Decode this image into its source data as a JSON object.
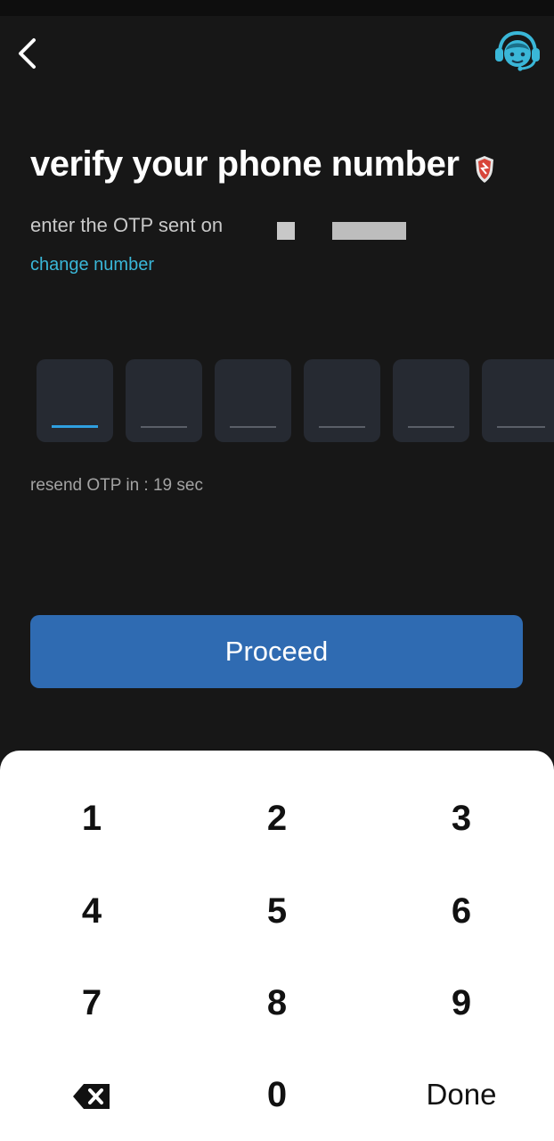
{
  "header": {
    "back_icon": "chevron-left-icon",
    "support_icon": "support-agent-headset-icon"
  },
  "title": "verify your phone number",
  "title_badge_icon": "shield-icon",
  "subtitle": "enter the OTP sent on",
  "change_number_label": "change number",
  "otp": {
    "length": 6,
    "values": [
      "",
      "",
      "",
      "",
      "",
      ""
    ],
    "active_index": 0
  },
  "resend_text": "resend OTP in : 19 sec",
  "proceed_label": "Proceed",
  "keypad": {
    "keys": [
      "1",
      "2",
      "3",
      "4",
      "5",
      "6",
      "7",
      "8",
      "9",
      "",
      "0",
      "Done"
    ],
    "backspace_icon": "backspace-icon"
  },
  "colors": {
    "background": "#171717",
    "accent_link": "#3ab7d8",
    "primary_button": "#2f6bb2",
    "otp_box": "#262a32",
    "otp_active_line": "#2f9fe0"
  }
}
